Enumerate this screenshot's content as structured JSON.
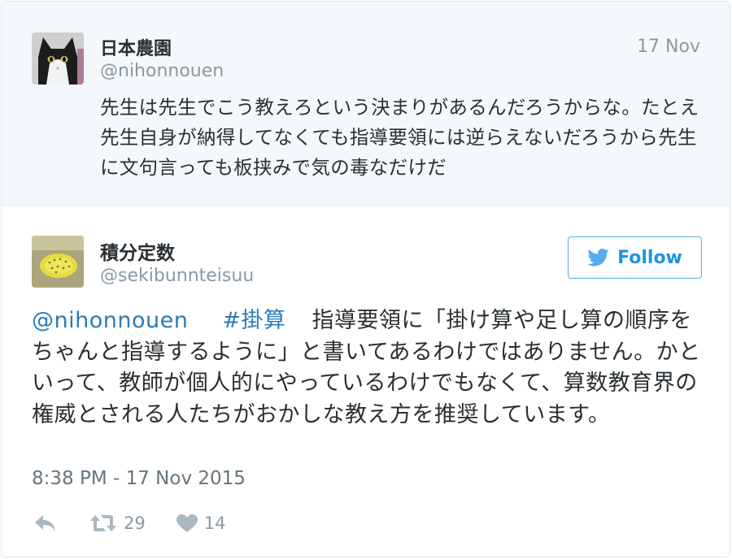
{
  "parent_tweet": {
    "display_name": "日本農園",
    "handle": "@nihonnouen",
    "date": "17 Nov",
    "text": "先生は先生でこう教えろという決まりがあるんだろうからな。たとえ先生自身が納得してなくても指導要領には逆らえないだろうから先生に文句言っても板挟みで気の毒なだけだ"
  },
  "main_tweet": {
    "display_name": "積分定数",
    "handle": "@sekibunnteisuu",
    "mention": "@nihonnouen",
    "hashtag": "#掛算",
    "body": "指導要領に「掛け算や足し算の順序をちゃんと指導するように」と書いてあるわけではありません。かといって、教師が個人的にやっているわけでもなくて、算数教育界の権威とされる人たちがおかしな教え方を推奨しています。",
    "timestamp": "8:38 PM - 17 Nov 2015",
    "retweet_count": "29",
    "like_count": "14",
    "follow_label": "Follow"
  },
  "icons": {
    "follow": "twitter-bird-icon",
    "reply": "reply-icon",
    "retweet": "retweet-icon",
    "like": "heart-icon"
  },
  "colors": {
    "link": "#2b7bb9",
    "follow_border": "#55acee",
    "muted": "#8899a6",
    "parent_bg": "#f5f8fa"
  }
}
